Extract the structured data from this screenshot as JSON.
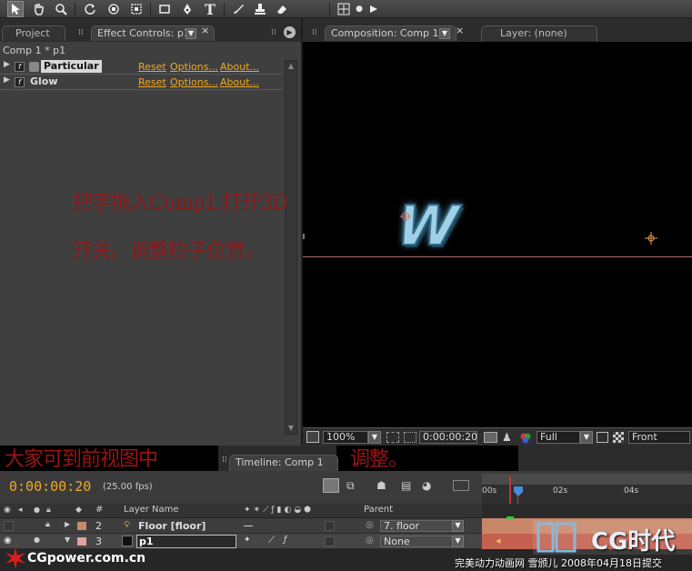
{
  "toolbar": {
    "tools": [
      "selection-tool-icon",
      "hand-tool-icon",
      "zoom-tool-icon",
      "rotate-tool-icon",
      "orbit-camera-icon",
      "track-camera-icon",
      "rectangle-mask-icon",
      "pen-tool-icon",
      "text-tool-icon",
      "brush-tool-icon",
      "clone-stamp-icon",
      "eraser-tool-icon",
      "axis-mode-icon"
    ]
  },
  "left_tabs": {
    "project": "Project",
    "effect_controls": "Effect Controls: p1"
  },
  "right_tabs": {
    "composition": "Composition: Comp 1",
    "layer": "Layer: (none)"
  },
  "effect_panel": {
    "path": "Comp 1 * p1",
    "effects": [
      {
        "name": "Particular",
        "reset": "Reset",
        "options": "Options...",
        "about": "About..."
      },
      {
        "name": "Glow",
        "reset": "Reset",
        "options": "Options...",
        "about": "About..."
      }
    ]
  },
  "comp_view": {
    "zoom": "100%",
    "timecode": "0:00:00:20",
    "resolution": "Full",
    "view": "Front",
    "letter": "W"
  },
  "annotations": {
    "line1": "把字拖入Comp1,打开3D",
    "line2": "开关。调整粒子位置。",
    "line3": "大家可到前视图中",
    "line4": "调整。"
  },
  "timeline": {
    "tab": "Timeline: Comp 1",
    "timecode": "0:00:00:20",
    "fps": "(25.00 fps)",
    "ruler": [
      "00s",
      "02s",
      "04s"
    ],
    "columns": {
      "hash": "#",
      "layer_name": "Layer Name",
      "parent": "Parent"
    },
    "layers": [
      {
        "num": "2",
        "name": "Floor [floor]",
        "parent": "7. floor",
        "color": "#c98a6a"
      },
      {
        "num": "3",
        "name": "p1",
        "parent": "None",
        "color": "#e0a0a0"
      }
    ]
  },
  "watermark": {
    "site": "CGpower.com.cn",
    "brand": "CG时代",
    "credit": "完美动力动画网 雪颁儿 2008年04月18日提交"
  },
  "colors": {
    "accent_link": "#f0a820",
    "timecode": "#f0a820",
    "annotation_red": "#8a1a1a",
    "layer_bar": "#c9876a"
  }
}
